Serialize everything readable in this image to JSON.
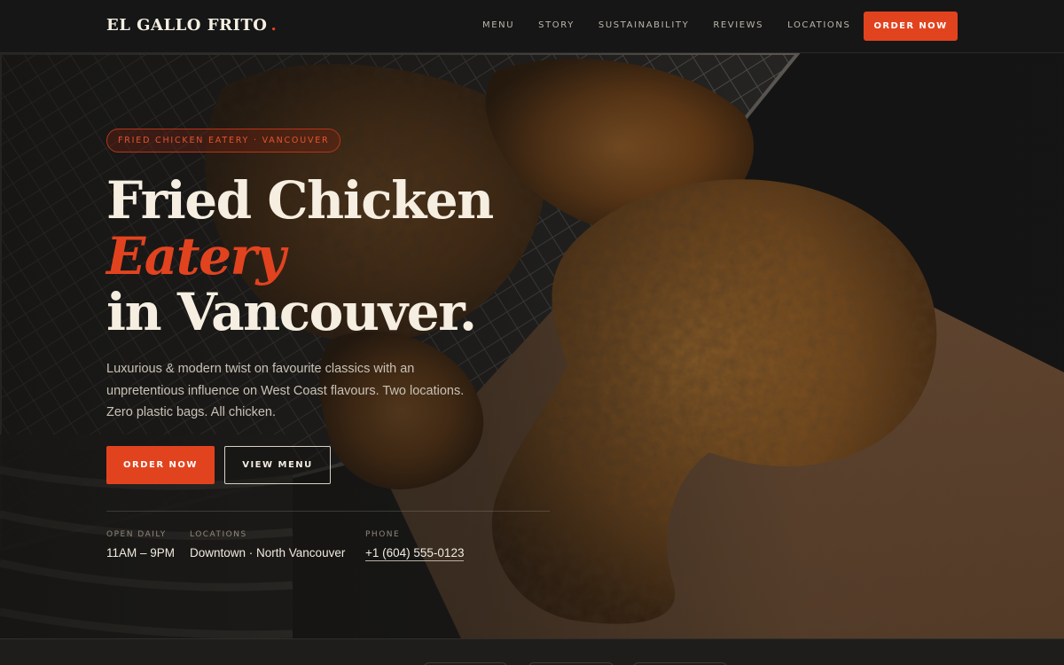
{
  "brand": {
    "name": "EL GALLO FRITO",
    "dot": "."
  },
  "nav": {
    "links": [
      "MENU",
      "STORY",
      "SUSTAINABILITY",
      "REVIEWS",
      "LOCATIONS"
    ],
    "cta": "ORDER NOW"
  },
  "hero": {
    "eyebrow": "FRIED CHICKEN EATERY · VANCOUVER",
    "headline_line1": "Fried Chicken",
    "headline_accent": "Eatery",
    "headline_line3": "in Vancouver.",
    "subtext": "Luxurious & modern twist on favourite classics with an unpretentious influence on West Coast flavours. Two locations. Zero plastic bags. All chicken.",
    "primary_button": "ORDER NOW",
    "secondary_button": "VIEW MENU"
  },
  "info": {
    "hours": {
      "label": "OPEN DAILY",
      "value": "11AM – 9PM"
    },
    "locations": {
      "label": "LOCATIONS",
      "value": "Downtown · North Vancouver"
    },
    "phone": {
      "label": "PHONE",
      "value": "+1 (604) 555-0123"
    }
  },
  "colors": {
    "accent": "#e2431f",
    "background": "#161616",
    "text": "#f5eee1"
  }
}
